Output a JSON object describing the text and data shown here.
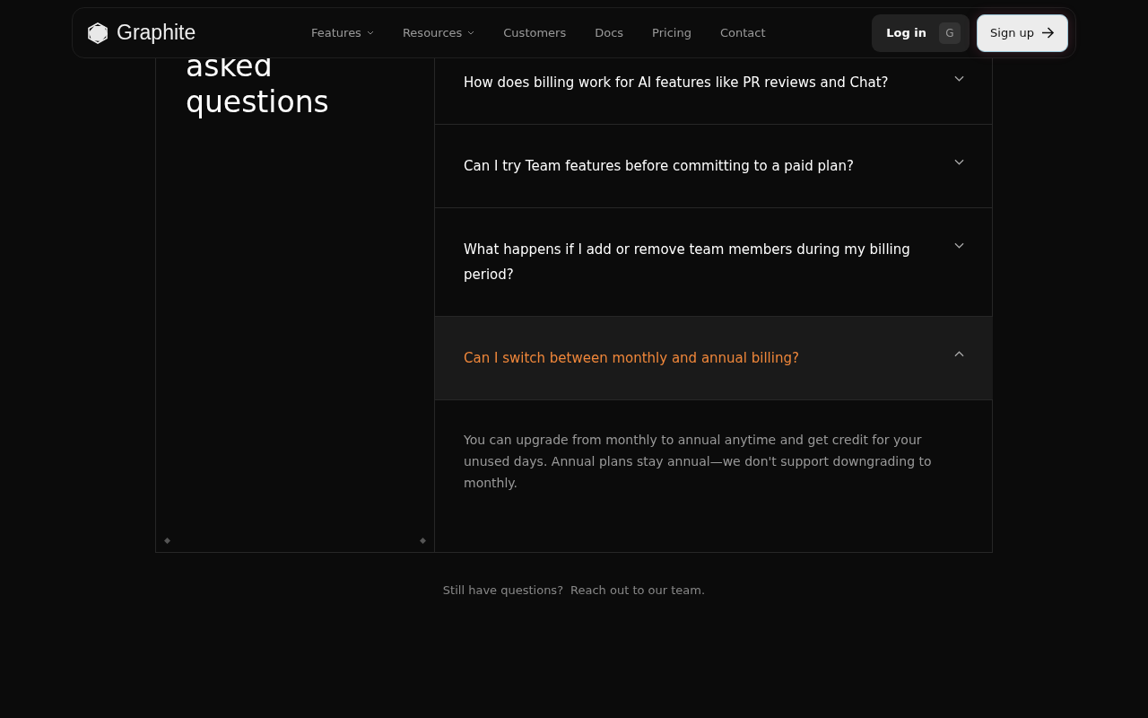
{
  "nav": {
    "brand": "Graphite",
    "links": [
      {
        "label": "Features",
        "dropdown": true
      },
      {
        "label": "Resources",
        "dropdown": true
      },
      {
        "label": "Customers",
        "dropdown": false
      },
      {
        "label": "Docs",
        "dropdown": false
      },
      {
        "label": "Pricing",
        "dropdown": false
      },
      {
        "label": "Contact",
        "dropdown": false
      }
    ],
    "login": {
      "label": "Log in",
      "shortcut": "G"
    },
    "signup": {
      "label": "Sign up"
    }
  },
  "faq": {
    "heading_lines": [
      "asked",
      "questions"
    ],
    "items": [
      {
        "question": "How does billing work for AI features like PR reviews and Chat?",
        "expanded": false
      },
      {
        "question": "Can I try Team features before committing to a paid plan?",
        "expanded": false
      },
      {
        "question": "What happens if I add or remove team members during my billing period?",
        "expanded": false
      },
      {
        "question": "Can I switch between monthly and annual billing?",
        "expanded": true,
        "answer": "You can upgrade from monthly to annual anytime and get credit for your unused days. Annual plans stay annual—we don't support downgrading to monthly."
      }
    ]
  },
  "footer": {
    "text": "Still have questions?",
    "link": "Reach out to our team."
  }
}
